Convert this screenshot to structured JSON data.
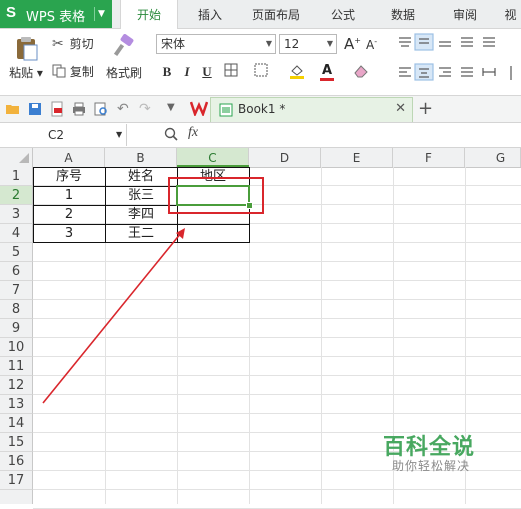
{
  "app": {
    "logo": "S",
    "name": "WPS 表格"
  },
  "tabs": [
    "开始",
    "插入",
    "页面布局",
    "公式",
    "数据",
    "审阅",
    "视"
  ],
  "ribbon": {
    "paste": "粘贴",
    "cut": "剪切",
    "copy": "复制",
    "format_painter": "格式刷",
    "font_name": "宋体",
    "font_size": "12",
    "grow_font": "A",
    "shrink_font": "A",
    "bold": "B",
    "italic": "I",
    "underline": "U"
  },
  "document": {
    "tab_title": "Book1 *"
  },
  "formula_bar": {
    "name_box": "C2",
    "fx": "fx"
  },
  "columns": [
    "A",
    "B",
    "C",
    "D",
    "E",
    "F",
    "G"
  ],
  "rows": [
    "1",
    "2",
    "3",
    "4",
    "5",
    "6",
    "7",
    "8",
    "9",
    "10",
    "11",
    "12",
    "13",
    "14",
    "15",
    "16",
    "17"
  ],
  "cells": {
    "a1": "序号",
    "b1": "姓名",
    "c1": "地区",
    "a2": "1",
    "b2": "张三",
    "a3": "2",
    "b3": "李四",
    "a4": "3",
    "b4": "王二"
  },
  "watermark": {
    "title": "百科全说",
    "subtitle": "助你轻松解决"
  },
  "colors": {
    "accent": "#2aa44f",
    "annotation": "#d9262c",
    "selection": "#4a9d3b"
  }
}
